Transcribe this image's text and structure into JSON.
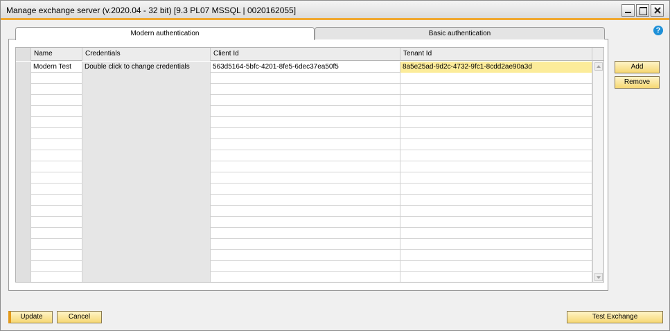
{
  "window": {
    "title": "Manage exchange server (v.2020.04 - 32 bit) [9.3 PL07 MSSQL | 0020162055]",
    "accent_color": "#f0a830"
  },
  "help": {
    "glyph": "?"
  },
  "tabs": [
    {
      "label": "Modern authentication",
      "active": true
    },
    {
      "label": "Basic authentication",
      "active": false
    }
  ],
  "grid": {
    "columns": [
      "",
      "Name",
      "Credentials",
      "Client Id",
      "Tenant Id"
    ],
    "rows": [
      {
        "name": "Modern Test",
        "credentials": "Double click to change credentials",
        "client_id": "563d5164-5bfc-4201-8fe5-6dec37ea50f5",
        "tenant_id": "8a5e25ad-9d2c-4732-9fc1-8cdd2ae90a3d"
      }
    ],
    "empty_rows": 19,
    "selected_color": "#fcec9a"
  },
  "side_buttons": {
    "add": "Add",
    "remove": "Remove"
  },
  "footer": {
    "update": "Update",
    "cancel": "Cancel",
    "test_exchange": "Test Exchange"
  }
}
